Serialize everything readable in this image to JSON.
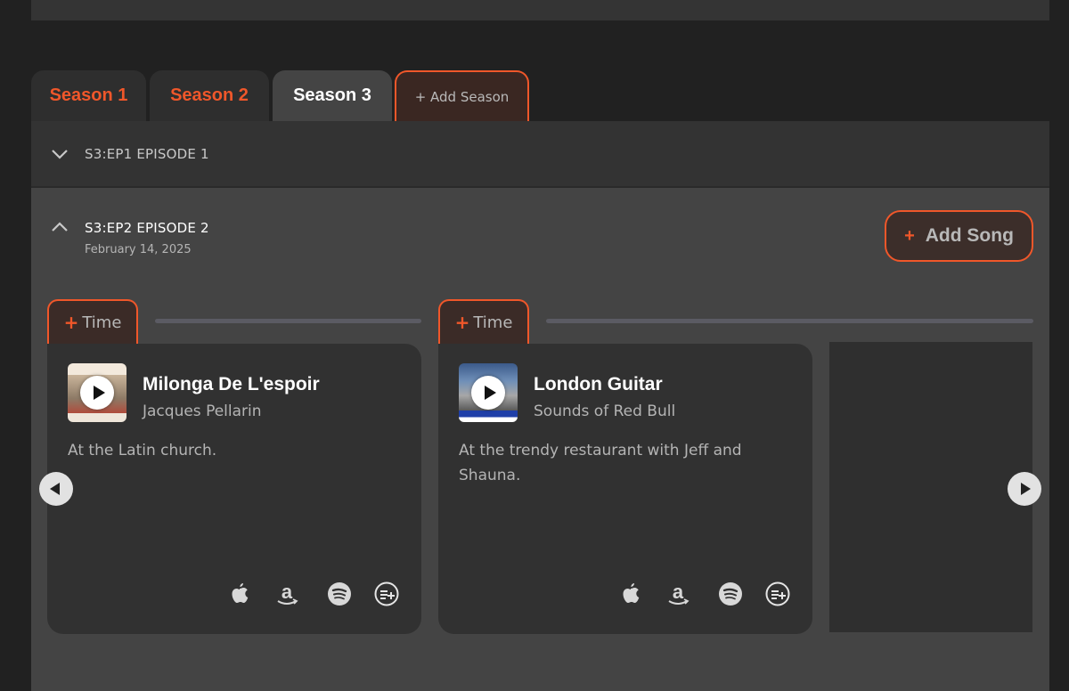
{
  "seasons": {
    "tabs": [
      {
        "label": "Season 1",
        "active": false
      },
      {
        "label": "Season 2",
        "active": false
      },
      {
        "label": "Season 3",
        "active": true
      }
    ],
    "add_label": "+ Add Season"
  },
  "episodes": [
    {
      "code_title": "S3:EP1 EPISODE 1",
      "expanded": false
    },
    {
      "code_title": "S3:EP2 EPISODE 2",
      "date": "February 14, 2025",
      "expanded": true
    }
  ],
  "add_song": {
    "plus": "+",
    "label": "Add Song"
  },
  "time_button": {
    "plus": "+",
    "label": "Time"
  },
  "songs": [
    {
      "title": "Milonga De L'espoir",
      "artist": "Jacques Pellarin",
      "note": "At the Latin church.",
      "services": [
        "apple-music-icon",
        "amazon-music-icon",
        "spotify-icon",
        "add-to-queue-icon"
      ]
    },
    {
      "title": "London Guitar",
      "artist": "Sounds of Red Bull",
      "note": "At the trendy restaurant with Jeff and Shauna.",
      "services": [
        "apple-music-icon",
        "amazon-music-icon",
        "spotify-icon",
        "add-to-queue-icon"
      ]
    }
  ],
  "colors": {
    "accent": "#f0572a",
    "panel": "#444444",
    "card": "#313131",
    "background": "#212121"
  }
}
